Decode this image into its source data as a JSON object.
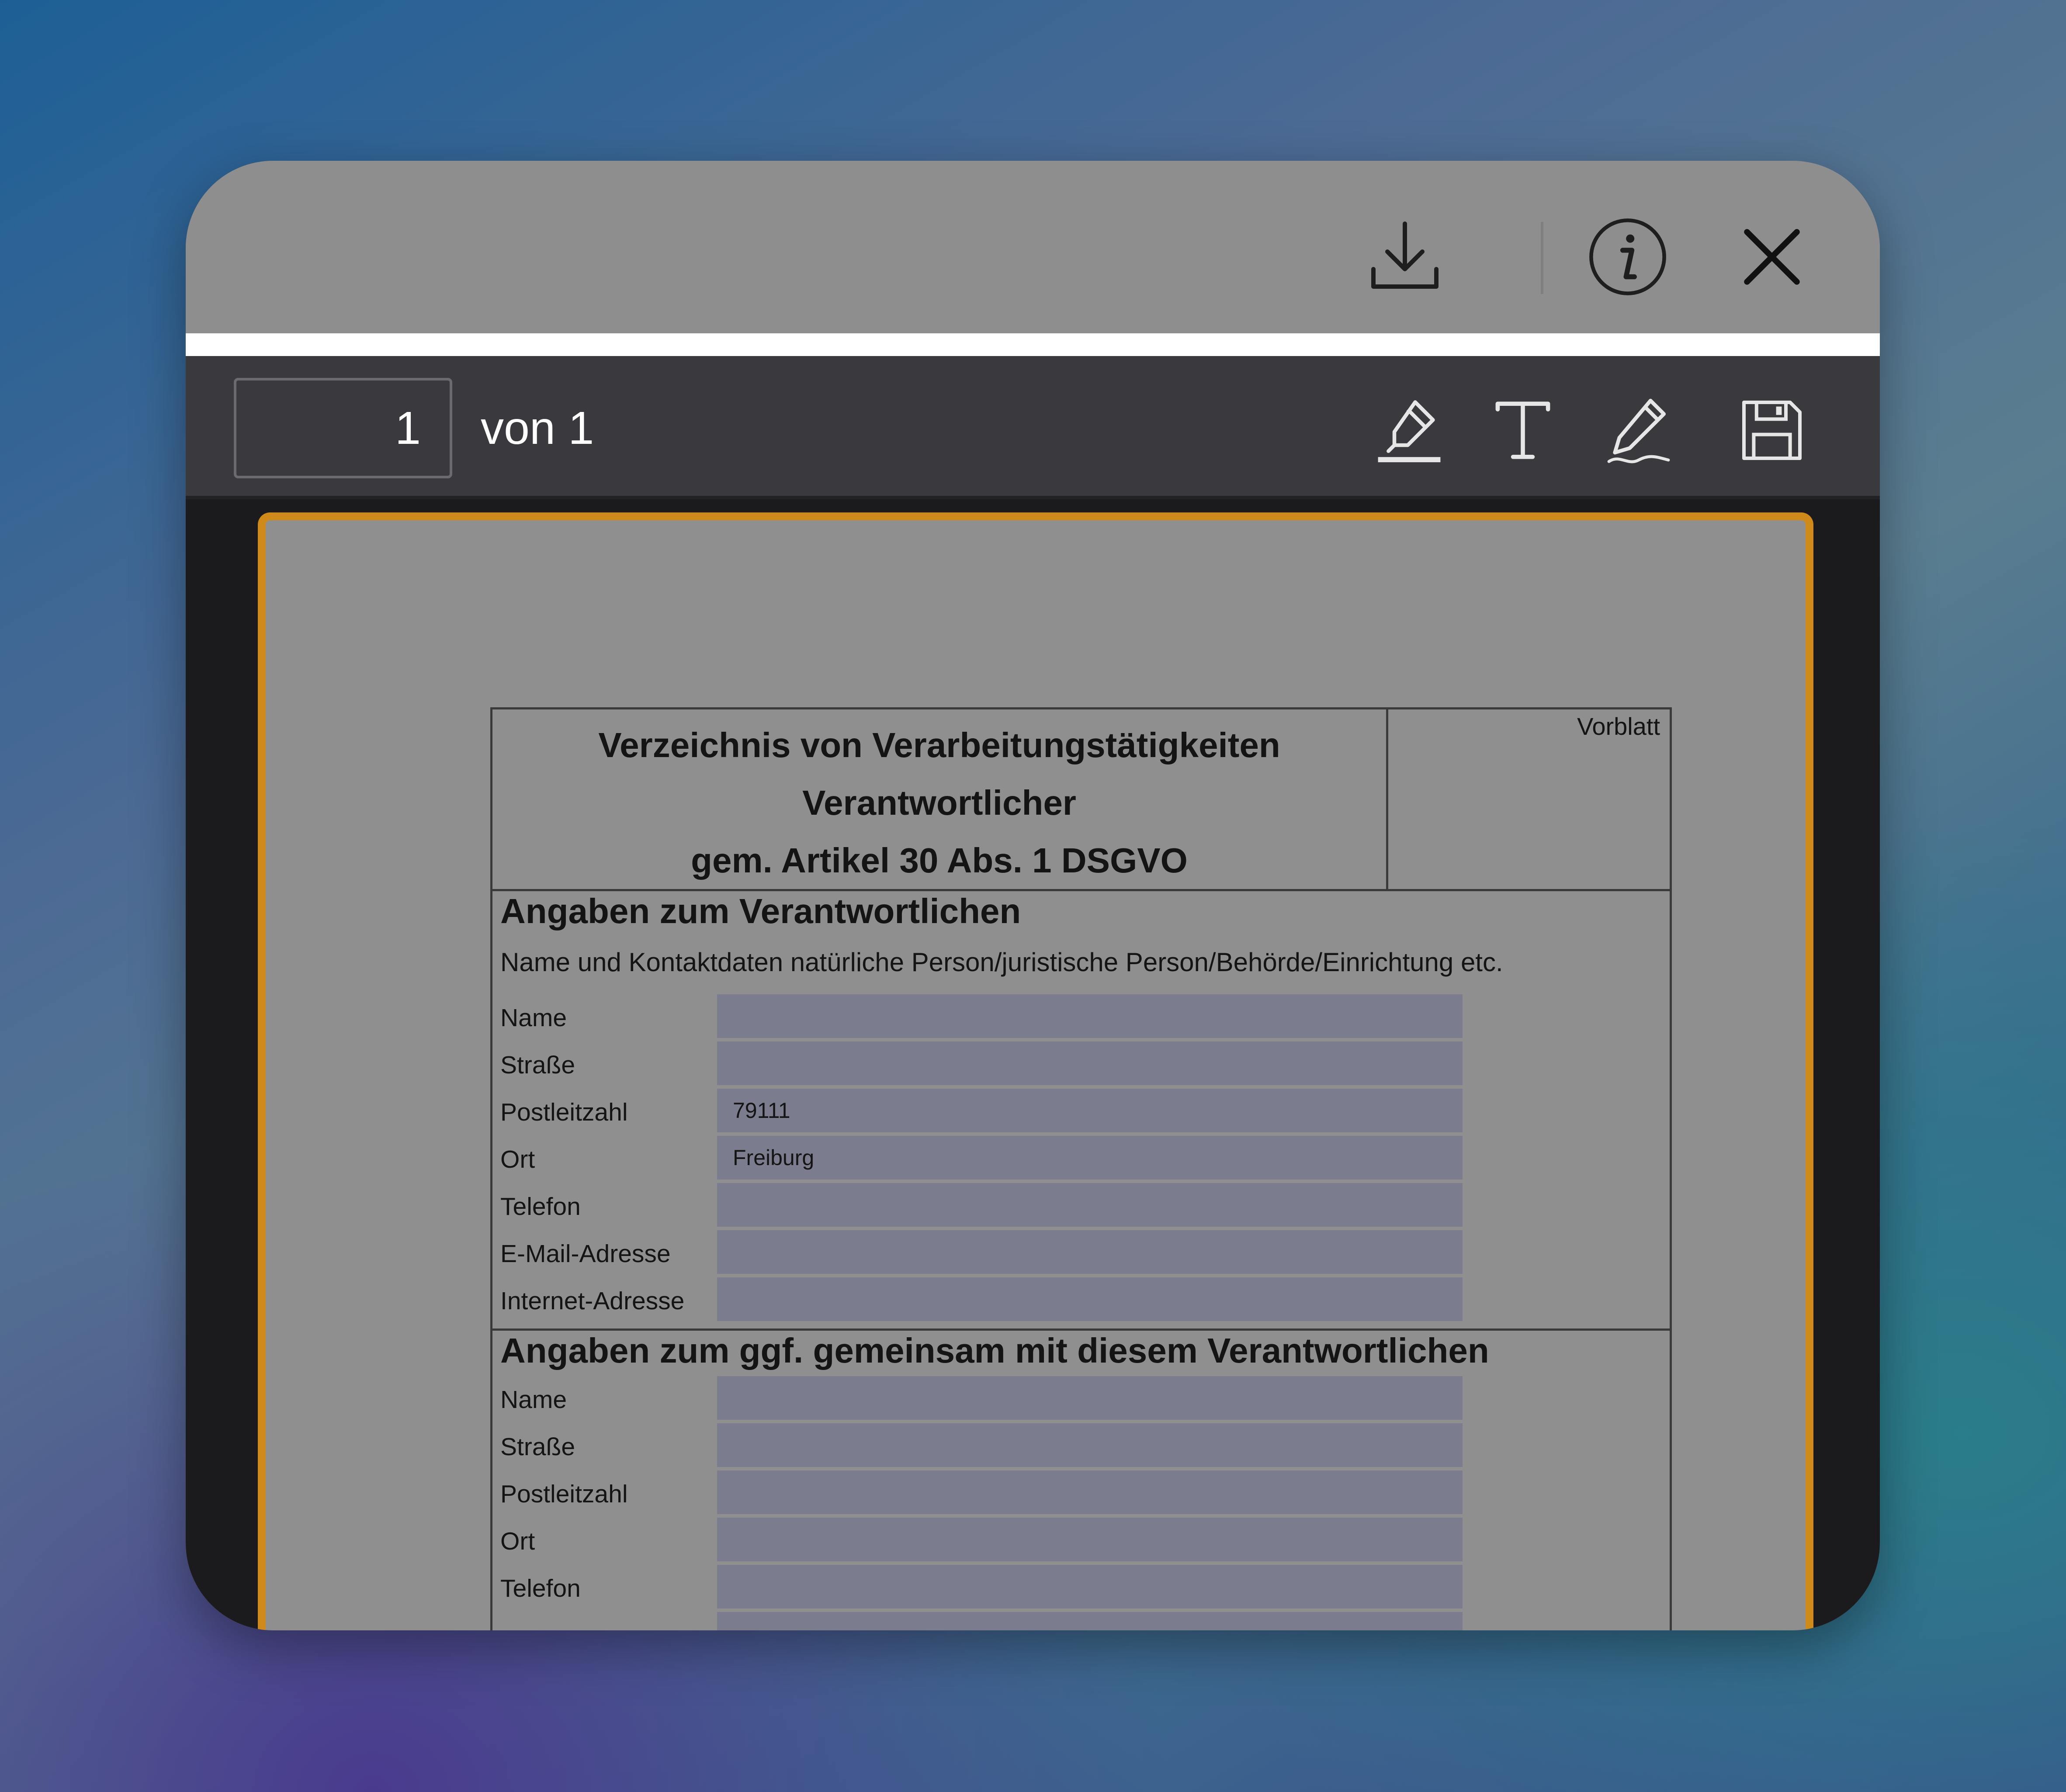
{
  "toolbar_top": {
    "download_icon": "download-icon",
    "info_icon": "info-icon",
    "close_icon": "close-icon"
  },
  "pager": {
    "current_page": "1",
    "of_label": "von 1"
  },
  "tools": {
    "highlight_icon": "highlighter-icon",
    "text_icon": "text-icon",
    "draw_icon": "pen-icon",
    "save_icon": "save-icon"
  },
  "document": {
    "title_lines": [
      "Verzeichnis von Verarbeitungstätigkeiten",
      "Verantwortlicher",
      "gem. Artikel 30 Abs. 1 DSGVO"
    ],
    "side_label": "Vorblatt",
    "section1": {
      "title": "Angaben zum Verantwortlichen",
      "subtitle": "Name und Kontaktdaten natürliche Person/juristische Person/Behörde/Einrichtung etc.",
      "rows": [
        {
          "label": "Name",
          "value": ""
        },
        {
          "label": "Straße",
          "value": ""
        },
        {
          "label": "Postleitzahl",
          "value": "79111"
        },
        {
          "label": "Ort",
          "value": "Freiburg"
        },
        {
          "label": "Telefon",
          "value": ""
        },
        {
          "label": "E-Mail-Adresse",
          "value": ""
        },
        {
          "label": "Internet-Adresse",
          "value": ""
        }
      ]
    },
    "section2": {
      "title": "Angaben zum ggf. gemeinsam mit diesem Verantwortlichen",
      "rows": [
        {
          "label": "Name",
          "value": ""
        },
        {
          "label": "Straße",
          "value": ""
        },
        {
          "label": "Postleitzahl",
          "value": ""
        },
        {
          "label": "Ort",
          "value": ""
        },
        {
          "label": "Telefon",
          "value": ""
        }
      ]
    }
  },
  "colors": {
    "accent_border": "#d08a1a",
    "field_fill": "#7b7d8e",
    "toolbar_bg": "#3a3a3e"
  }
}
